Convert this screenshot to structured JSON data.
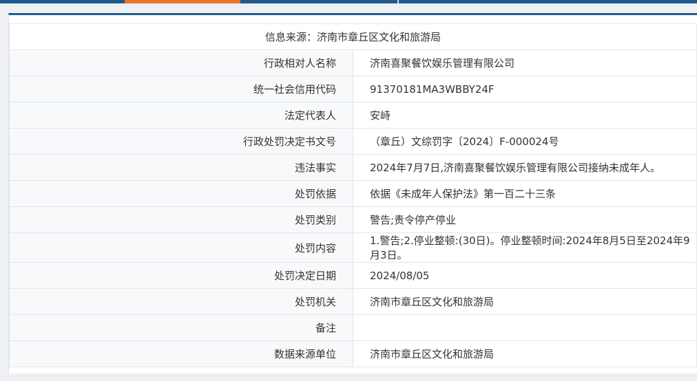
{
  "header": {
    "source": "信息来源：济南市章丘区文化和旅游局"
  },
  "rows": [
    {
      "label": "行政相对人名称",
      "value": "济南喜聚餐饮娱乐管理有限公司"
    },
    {
      "label": "统一社会信用代码",
      "value": "91370181MA3WBBY24F"
    },
    {
      "label": "法定代表人",
      "value": "安峙"
    },
    {
      "label": "行政处罚决定书文号",
      "value": "（章丘）文综罚字〔2024〕F-000024号"
    },
    {
      "label": "违法事实",
      "value": "2024年7月7日,济南喜聚餐饮娱乐管理有限公司接纳未成年人。"
    },
    {
      "label": "处罚依据",
      "value": "依据《未成年人保护法》第一百二十三条"
    },
    {
      "label": "处罚类别",
      "value": "警告;责令停产停业"
    },
    {
      "label": "处罚内容",
      "value": "1.警告;2.停业整顿:(30日)。停业整顿时间:2024年8月5日至2024年9月3日。"
    },
    {
      "label": "处罚决定日期",
      "value": "2024/08/05"
    },
    {
      "label": "处罚机关",
      "value": "济南市章丘区文化和旅游局"
    },
    {
      "label": "备注",
      "value": ""
    },
    {
      "label": "数据来源单位",
      "value": "济南市章丘区文化和旅游局"
    }
  ],
  "colors": {
    "accent": "#e4772c",
    "brand": "#1f5a8f",
    "label_text": "#1f4f82"
  }
}
